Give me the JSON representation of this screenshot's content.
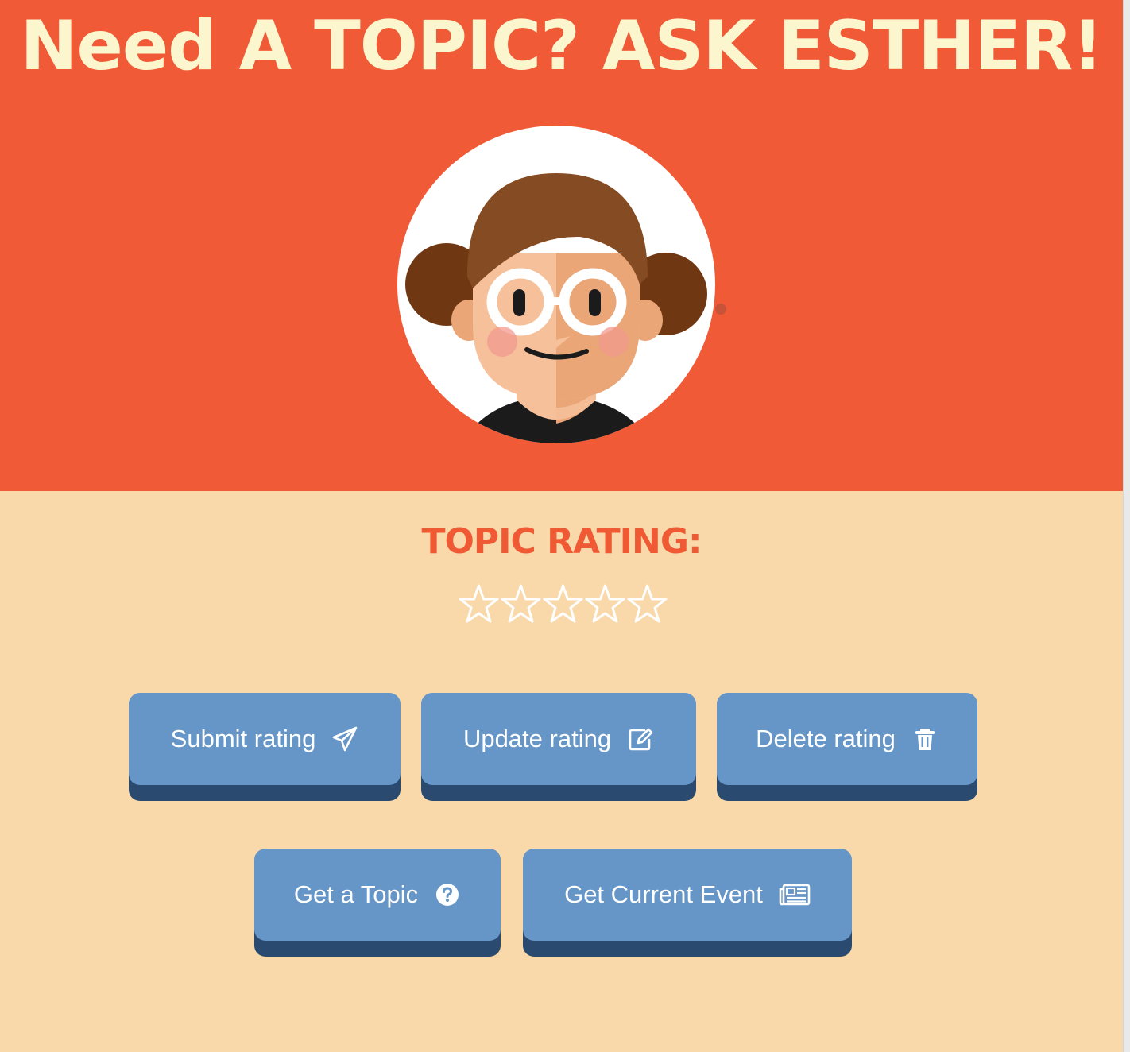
{
  "header": {
    "title": "Need A TOPIC? ASK ESTHER!"
  },
  "avatar": {
    "icon": "esther-avatar-illustration"
  },
  "rating": {
    "heading": "TOPIC RATING:",
    "stars_total": 5,
    "stars_filled": 0
  },
  "buttons": {
    "submit": {
      "label": "Submit rating",
      "icon": "paper-plane-icon"
    },
    "update": {
      "label": "Update rating",
      "icon": "edit-icon"
    },
    "delete": {
      "label": "Delete rating",
      "icon": "trash-icon"
    },
    "get_topic": {
      "label": "Get a Topic",
      "icon": "question-circle-icon"
    },
    "current_event": {
      "label": "Get Current Event",
      "icon": "newspaper-icon"
    }
  },
  "colors": {
    "hero_bg": "#f05a36",
    "page_bg": "#f9d8aa",
    "title_text": "#fcf6cf",
    "heading_text": "#ef5a34",
    "button_bg": "#6596c7",
    "button_shadow": "#2b4a6f"
  }
}
